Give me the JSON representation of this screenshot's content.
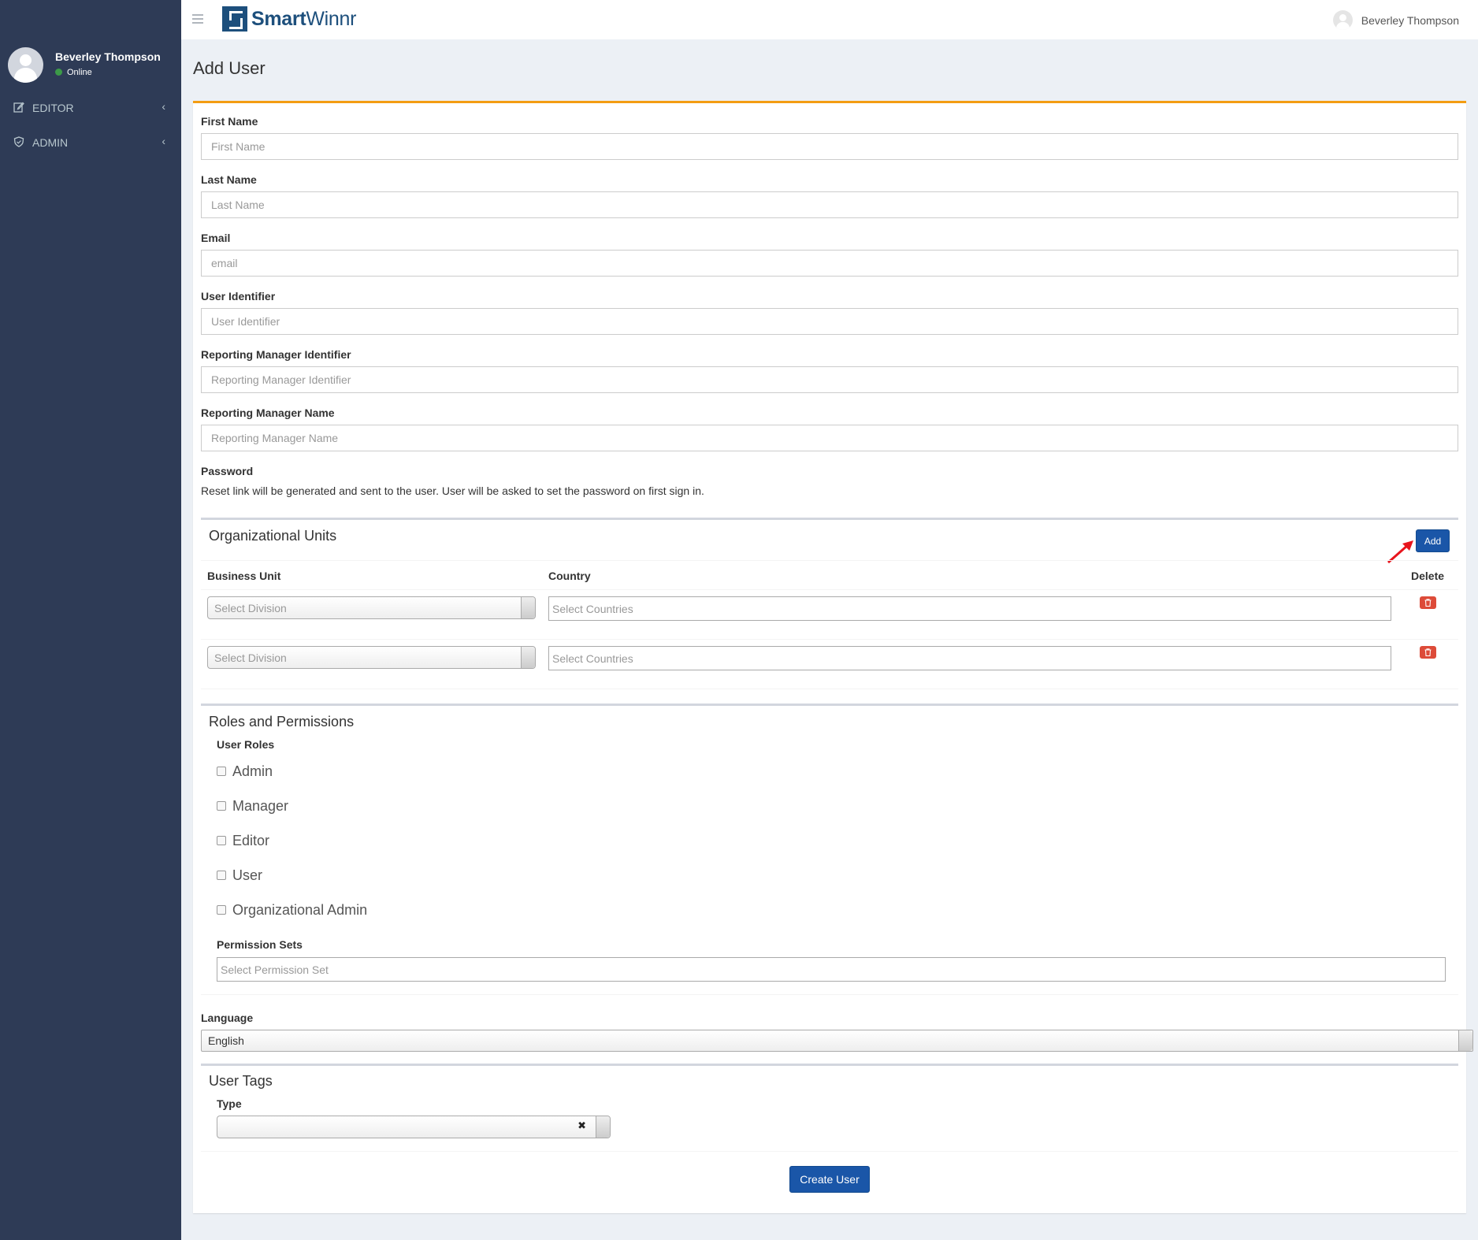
{
  "header": {
    "brand_first": "Smart",
    "brand_second": "Winnr",
    "user_name": "Beverley Thompson"
  },
  "sidebar": {
    "user_name": "Beverley Thompson",
    "status": "Online",
    "items": [
      {
        "label": "EDITOR",
        "icon": "edit-icon"
      },
      {
        "label": "ADMIN",
        "icon": "shield-icon"
      }
    ]
  },
  "page": {
    "title": "Add User"
  },
  "form": {
    "first_name": {
      "label": "First Name",
      "placeholder": "First Name"
    },
    "last_name": {
      "label": "Last Name",
      "placeholder": "Last Name"
    },
    "email": {
      "label": "Email",
      "placeholder": "email"
    },
    "user_identifier": {
      "label": "User Identifier",
      "placeholder": "User Identifier"
    },
    "reporting_manager_identifier": {
      "label": "Reporting Manager Identifier",
      "placeholder": "Reporting Manager Identifier"
    },
    "reporting_manager_name": {
      "label": "Reporting Manager Name",
      "placeholder": "Reporting Manager Name"
    },
    "password": {
      "label": "Password",
      "note": "Reset link will be generated and sent to the user. User will be asked to set the password on first sign in."
    }
  },
  "org_units": {
    "title": "Organizational Units",
    "add_label": "Add",
    "columns": [
      "Business Unit",
      "Country",
      "Delete"
    ],
    "rows": [
      {
        "division_placeholder": "Select Division",
        "country_placeholder": "Select Countries"
      },
      {
        "division_placeholder": "Select Division",
        "country_placeholder": "Select Countries"
      }
    ]
  },
  "roles": {
    "title": "Roles and Permissions",
    "user_roles_label": "User Roles",
    "options": [
      "Admin",
      "Manager",
      "Editor",
      "User",
      "Organizational Admin"
    ],
    "permission_sets_label": "Permission Sets",
    "permission_sets_placeholder": "Select Permission Set"
  },
  "language": {
    "label": "Language",
    "value": "English"
  },
  "tags": {
    "title": "User Tags",
    "type_label": "Type",
    "clear_symbol": "✖"
  },
  "actions": {
    "create_label": "Create User"
  },
  "colors": {
    "sidebar_bg": "#2e3b56",
    "primary": "#1a56a8",
    "accent_top": "#f39c12",
    "danger": "#dd4b39",
    "online": "#3c9a48"
  }
}
